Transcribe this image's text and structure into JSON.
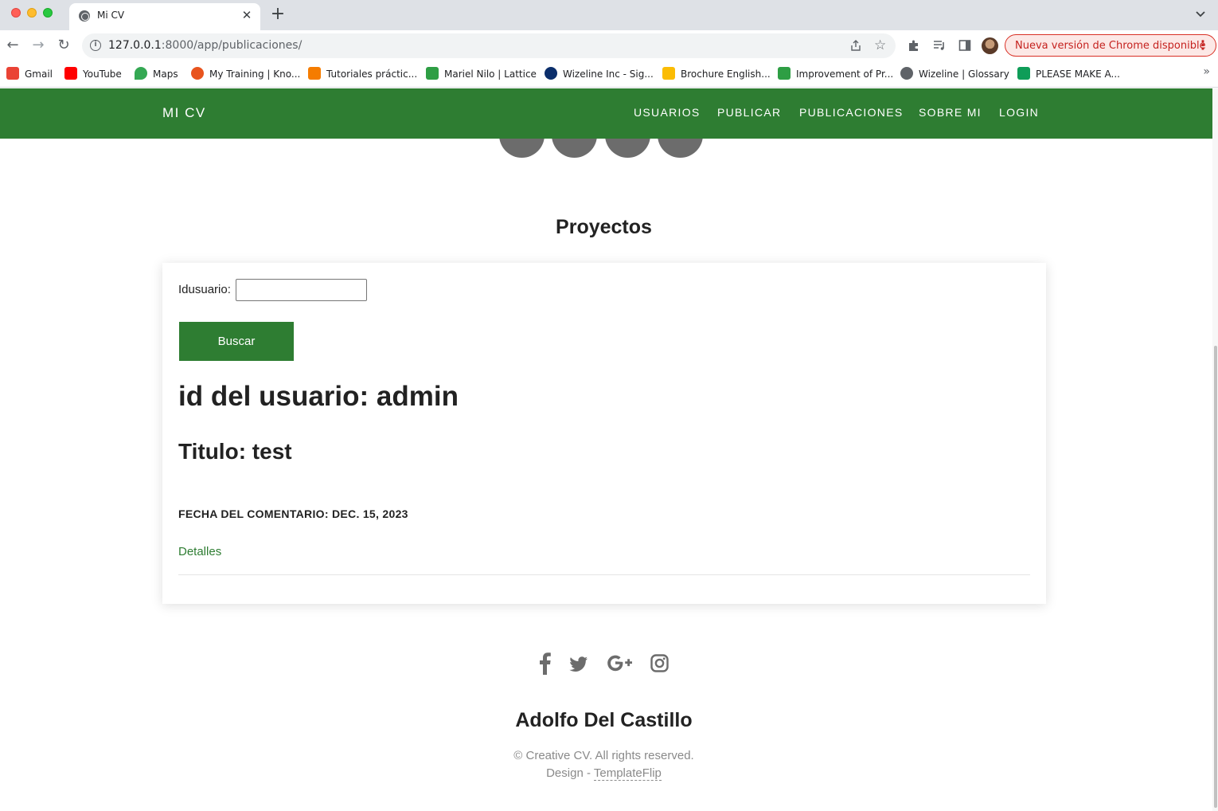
{
  "browser": {
    "tab_title": "Mi CV",
    "url_host": "127.0.0.1",
    "url_path": ":8000/app/publicaciones/",
    "update_label": "Nueva versión de Chrome disponible",
    "bookmarks": [
      {
        "label": "Gmail",
        "color": "#ea4335"
      },
      {
        "label": "YouTube",
        "color": "#ff0000"
      },
      {
        "label": "Maps",
        "color": "#34a853"
      },
      {
        "label": "My Training | Kno...",
        "color": "#e8541e"
      },
      {
        "label": "Tutoriales práctic...",
        "color": "#f57c00"
      },
      {
        "label": "Mariel Nilo | Lattice",
        "color": "#2e9e44"
      },
      {
        "label": "Wizeline Inc - Sig...",
        "color": "#0b2e6b"
      },
      {
        "label": "Brochure English...",
        "color": "#fbbc04"
      },
      {
        "label": "Improvement of Pr...",
        "color": "#2e9e44"
      },
      {
        "label": "Wizeline | Glossary",
        "color": "#5f6368"
      },
      {
        "label": "PLEASE MAKE A...",
        "color": "#0f9d58"
      }
    ]
  },
  "navbar": {
    "brand": "MI CV",
    "links": [
      "USUARIOS",
      "PUBLICAR",
      "PUBLICACIONES",
      "SOBRE MI",
      "LOGIN"
    ],
    "color": "#2e7d32"
  },
  "main": {
    "section_title": "Proyectos",
    "search": {
      "label": "Idusuario:",
      "value": "",
      "button": "Buscar"
    },
    "post": {
      "user_heading": "id del usuario: admin",
      "title_heading": "Titulo: test",
      "date_line": "FECHA DEL COMENTARIO: DEC. 15, 2023",
      "details_link": "Detalles"
    }
  },
  "footer": {
    "social_icons": [
      "facebook-icon",
      "twitter-icon",
      "google-plus-icon",
      "instagram-icon"
    ],
    "name": "Adolfo Del Castillo",
    "copyright": "© Creative CV. All rights reserved.",
    "design_prefix": "Design - ",
    "design_link": "TemplateFlip"
  }
}
